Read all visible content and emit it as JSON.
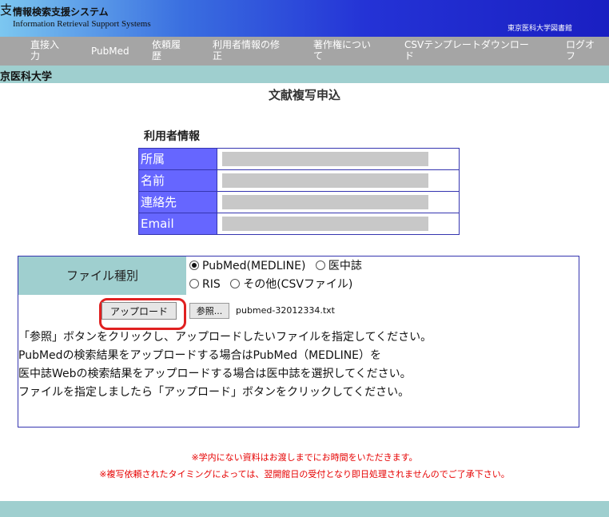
{
  "header": {
    "logo_char": "支",
    "system_name_jp": "情報検索支援システム",
    "system_name_en": "Information Retrieval Support Systems",
    "library_name": "東京医科大学図書館"
  },
  "nav": {
    "items": [
      {
        "line1": "直接入",
        "line2": "力"
      },
      {
        "line1": "PubMed",
        "line2": ""
      },
      {
        "line1": "依頼履",
        "line2": "歴"
      },
      {
        "line1": "利用者情報の修",
        "line2": "正"
      },
      {
        "line1": "著作権につい",
        "line2": "て"
      },
      {
        "line1": "CSVテンプレートダウンロー",
        "line2": "ド"
      },
      {
        "line1": "ログオ",
        "line2": "フ"
      }
    ]
  },
  "univ_band": {
    "name": "京医科大学"
  },
  "page_title": "文献複写申込",
  "user_info": {
    "title": "利用者情報",
    "rows": [
      {
        "label": "所属"
      },
      {
        "label": "名前"
      },
      {
        "label": "連絡先"
      },
      {
        "label": "Email"
      }
    ]
  },
  "upload": {
    "file_type_label": "ファイル種別",
    "options": [
      {
        "label": "PubMed(MEDLINE)",
        "selected": true
      },
      {
        "label": "医中誌",
        "selected": false
      },
      {
        "label": "RIS",
        "selected": false
      },
      {
        "label": "その他(CSVファイル)",
        "selected": false
      }
    ],
    "upload_button": "アップロード",
    "browse_button": "参照...",
    "file_name": "pubmed-32012334.txt",
    "instructions": [
      "「参照」ボタンをクリックし、アップロードしたいファイルを指定してください。",
      "PubMedの検索結果をアップロードする場合はPubMed（MEDLINE）を",
      "医中誌Webの検索結果をアップロードする場合は医中誌を選択してください。",
      "ファイルを指定しましたら「アップロード」ボタンをクリックしてください。"
    ]
  },
  "notes": [
    "※学内にない資料はお渡しまでにお時間をいただきます。",
    "※複写依頼されたタイミングによっては、翌開館日の受付となり即日処理されませんのでご了承下さい。"
  ],
  "colors": {
    "label_bg": "#6666ff",
    "teal_band": "#9fcfcf",
    "nav_bg": "#a5a5a5",
    "border": "#3535b0",
    "note_red": "#e60000",
    "highlight_ring": "#e02020"
  }
}
